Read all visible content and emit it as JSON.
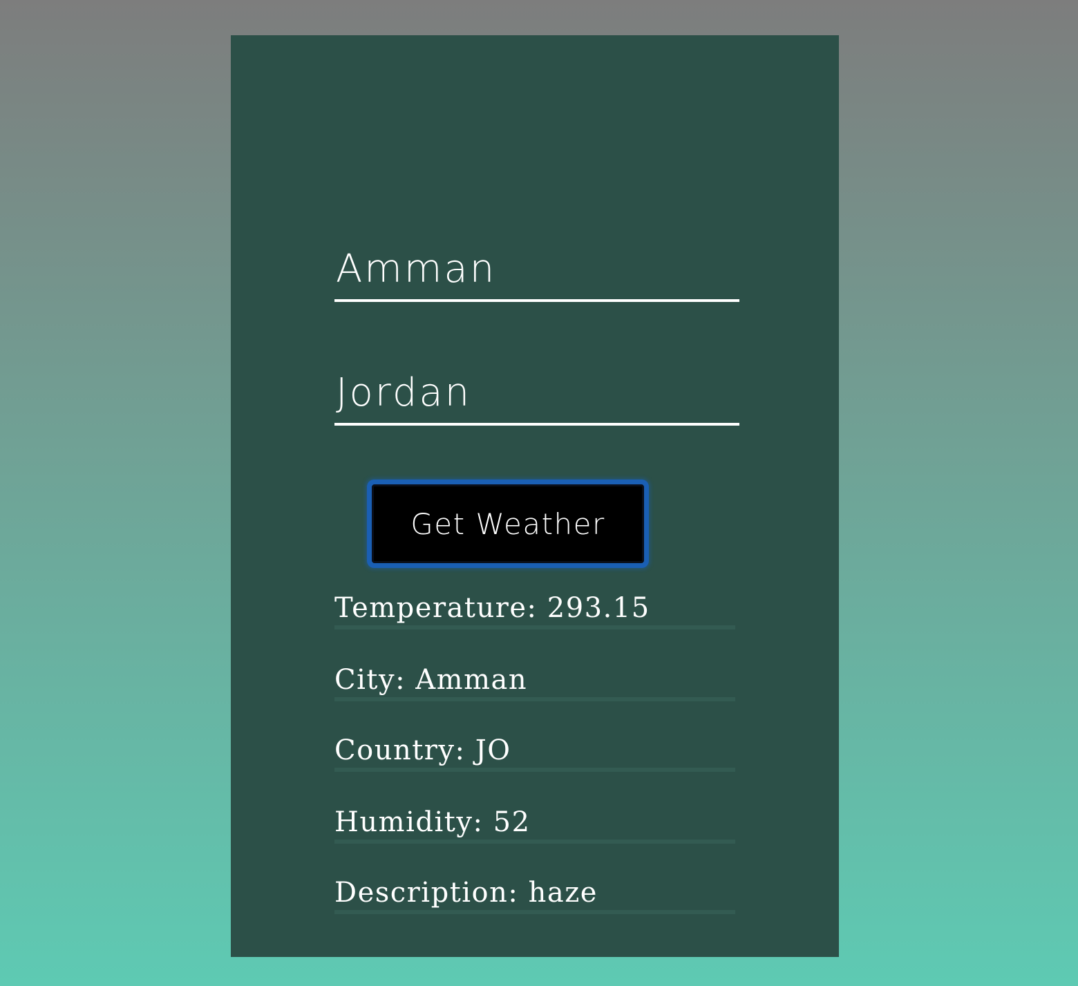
{
  "form": {
    "city_value": "Amman",
    "country_value": "Jordan",
    "submit_label": "Get Weather"
  },
  "results": {
    "temperature": "Temperature: 293.15",
    "city": "City: Amman",
    "country": "Country: JO",
    "humidity": "Humidity: 52",
    "description": "Description: haze"
  },
  "colors": {
    "background_top": "#7d7d7d",
    "background_bottom": "#5ecab3",
    "panel": "#2c5048",
    "button_background": "#000000",
    "button_focus_ring": "#1a5fb4",
    "text": "#ffffff",
    "row_divider": "#335b52"
  }
}
